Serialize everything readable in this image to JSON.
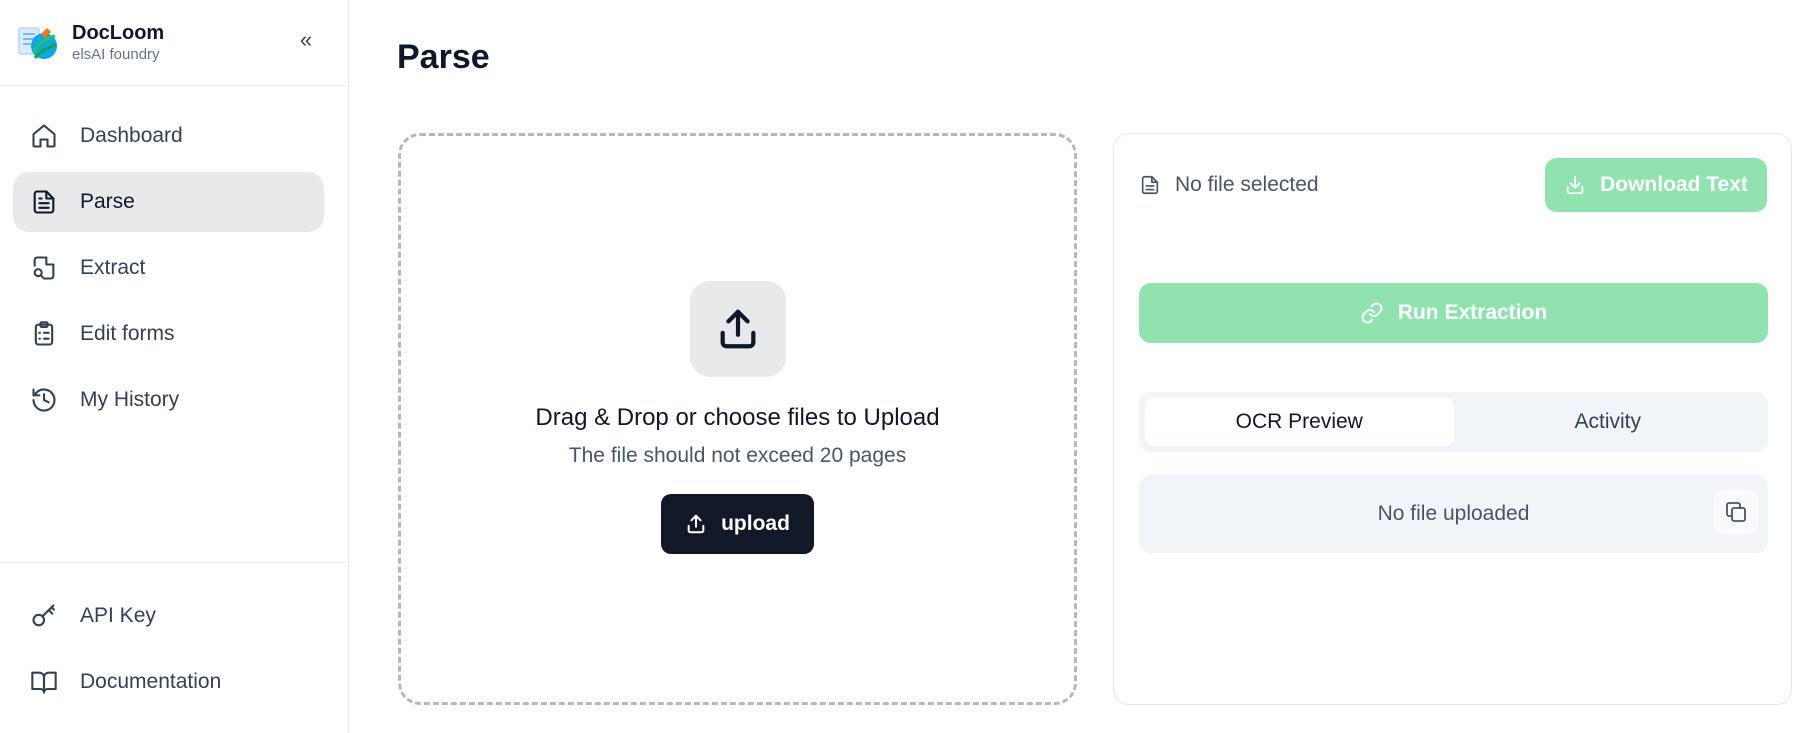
{
  "brand": {
    "name": "DocLoom",
    "subtitle": "elsAI foundry",
    "collapse_glyph": "«"
  },
  "sidebar": {
    "items": [
      {
        "label": "Dashboard",
        "icon": "home-icon",
        "active": false
      },
      {
        "label": "Parse",
        "icon": "file-text-icon",
        "active": true
      },
      {
        "label": "Extract",
        "icon": "file-search-icon",
        "active": false
      },
      {
        "label": "Edit forms",
        "icon": "clipboard-list-icon",
        "active": false
      },
      {
        "label": "My History",
        "icon": "history-icon",
        "active": false
      }
    ],
    "bottom_items": [
      {
        "label": "API Key",
        "icon": "key-icon"
      },
      {
        "label": "Documentation",
        "icon": "book-open-icon"
      }
    ]
  },
  "main": {
    "title": "Parse",
    "dropzone": {
      "title": "Drag & Drop or choose files to Upload",
      "subtitle": "The file should not exceed 20 pages",
      "upload_label": "upload",
      "icon": "upload-icon"
    },
    "panel": {
      "file_status": "No file selected",
      "download_label": "Download Text",
      "run_label": "Run Extraction",
      "tabs": [
        {
          "label": "OCR Preview",
          "active": true
        },
        {
          "label": "Activity",
          "active": false
        }
      ],
      "preview_text": "No file uploaded"
    }
  },
  "colors": {
    "accent_disabled": "#90e3ae",
    "primary_dark": "#111827",
    "active_nav_bg": "#e8e9eb",
    "muted_bg": "#f1f5f9"
  }
}
